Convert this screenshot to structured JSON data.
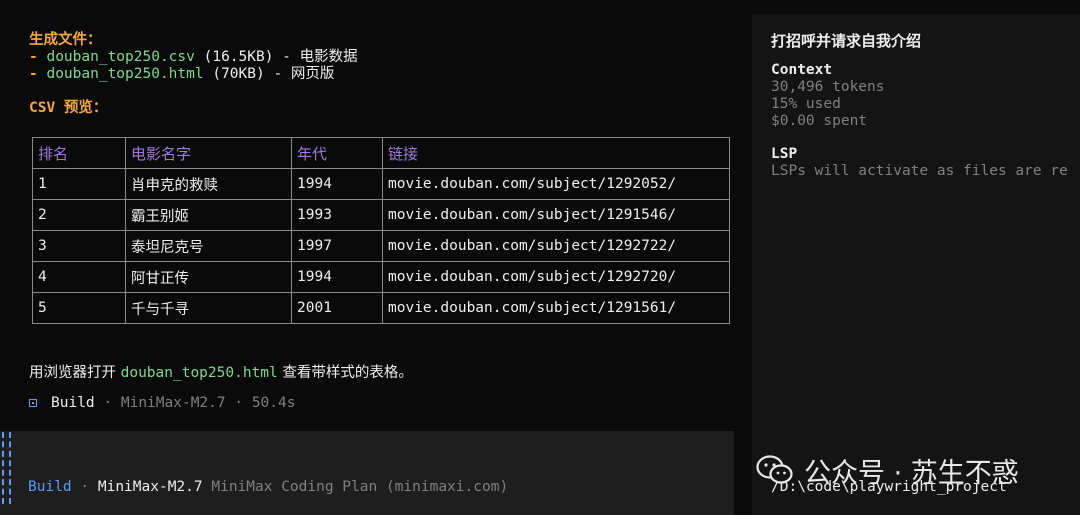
{
  "output": {
    "generated_title": "生成文件：",
    "files": [
      {
        "prefix": "- ",
        "name": "douban_top250.csv",
        "size": " (16.5KB) - ",
        "desc": "电影数据"
      },
      {
        "prefix": "- ",
        "name": "douban_top250.html",
        "size": " (70KB) - ",
        "desc": "网页版"
      }
    ],
    "csv_preview_title": "CSV 预览：",
    "table": {
      "headers": [
        "排名",
        "电影名字",
        "年代",
        "链接"
      ],
      "rows": [
        [
          "1",
          "肖申克的救赎",
          "1994",
          "movie.douban.com/subject/1292052/"
        ],
        [
          "2",
          "霸王别姬",
          "1993",
          "movie.douban.com/subject/1291546/"
        ],
        [
          "3",
          "泰坦尼克号",
          "1997",
          "movie.douban.com/subject/1292722/"
        ],
        [
          "4",
          "阿甘正传",
          "1994",
          "movie.douban.com/subject/1292720/"
        ],
        [
          "5",
          "千与千寻",
          "2001",
          "movie.douban.com/subject/1291561/"
        ]
      ]
    },
    "open_hint": {
      "before": "用浏览器打开 ",
      "file": "douban_top250.html",
      "after": " 查看带样式的表格。"
    },
    "build_status": {
      "mode": "Build",
      "model": "MiniMax-M2.7",
      "duration": "50.4s",
      "separator": " · "
    }
  },
  "input": {
    "mode": "Build",
    "model": "MiniMax-M2.7",
    "provider": "MiniMax Coding Plan (minimaxi.com)",
    "separator": " · "
  },
  "sidebar": {
    "title": "打招呼并请求自我介绍",
    "context": {
      "heading": "Context",
      "tokens": "30,496 tokens",
      "used": "15% used",
      "spent": "$0.00 spent"
    },
    "lsp": {
      "heading": "LSP",
      "message": "LSPs will activate as files are re"
    },
    "path": "/D:\\code\\playwright_project"
  },
  "watermark": {
    "text": "公众号 · 苏生不惑",
    "icon": "wechat-icon"
  },
  "colors": {
    "background": "#0a0a0a",
    "sidebar_bg": "#141414",
    "input_bg": "#1e1e1e",
    "accent_orange": "#f5a742",
    "accent_green": "#7fd88f",
    "accent_blue": "#5c9cf5",
    "accent_purple": "#9d7cd8",
    "muted_gray": "#808080"
  }
}
